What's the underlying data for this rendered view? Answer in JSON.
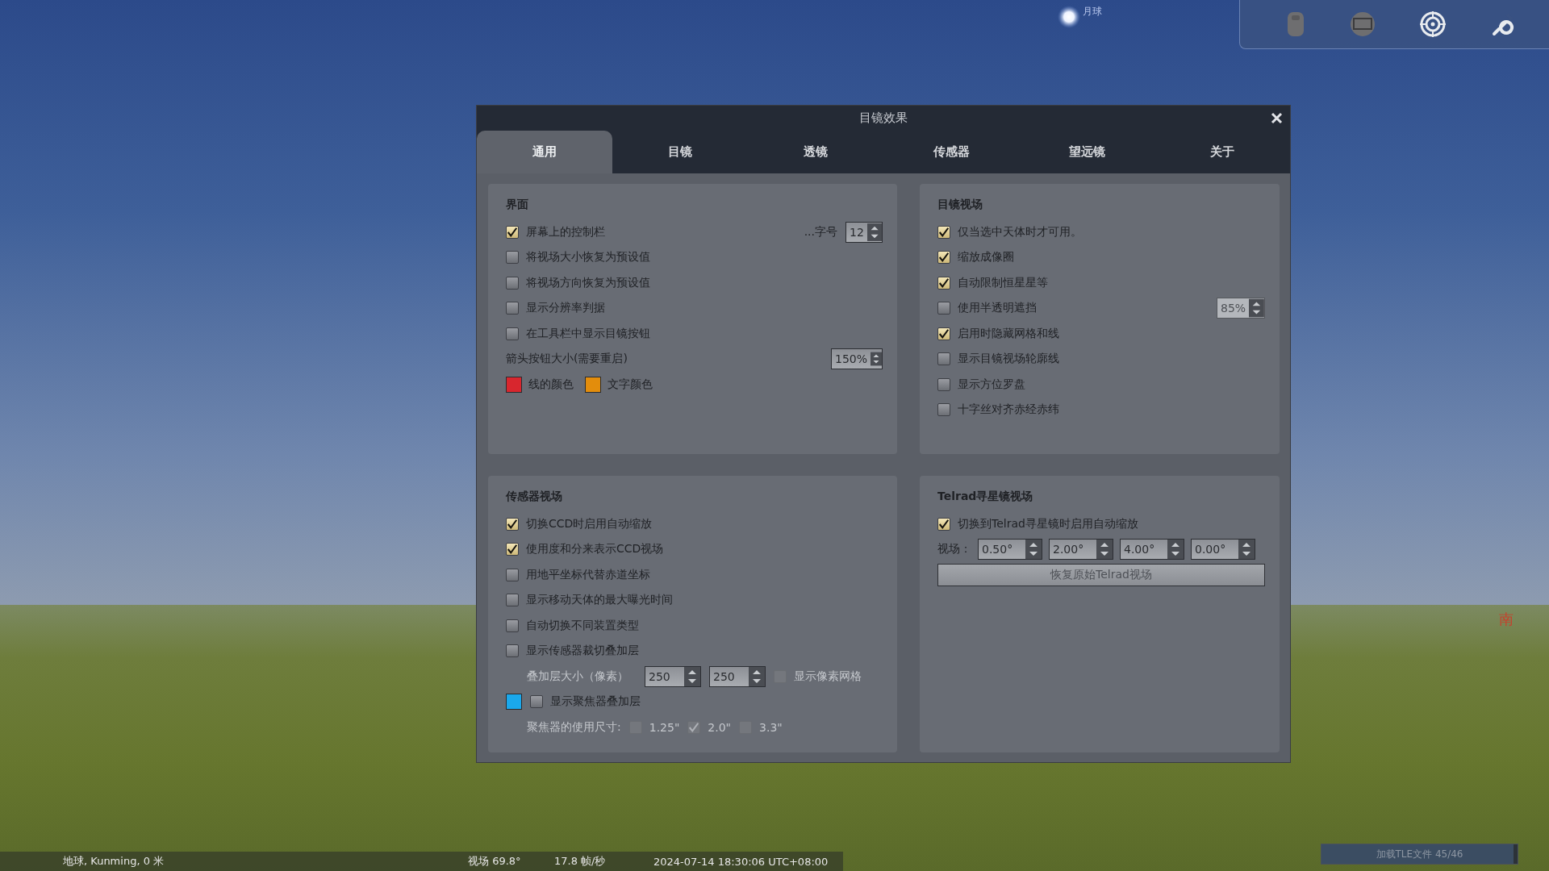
{
  "sky": {
    "moon_label": "月球",
    "cardinal": "南"
  },
  "dialog": {
    "title": "目镜效果",
    "tabs": [
      {
        "label": "通用",
        "selected": true
      },
      {
        "label": "目镜",
        "selected": false
      },
      {
        "label": "透镜",
        "selected": false
      },
      {
        "label": "传感器",
        "selected": false
      },
      {
        "label": "望远镜",
        "selected": false
      },
      {
        "label": "关于",
        "selected": false
      }
    ],
    "panels": [
      {
        "title": "界面",
        "rows": [
          {
            "kind": "check",
            "label": "屏幕上的控制栏",
            "checked": true,
            "spin": {
              "label": "...字号",
              "value": "12",
              "disabled": false
            }
          },
          {
            "kind": "check",
            "label": "将视场大小恢复为预设值",
            "checked": false
          },
          {
            "kind": "check",
            "label": "将视场方向恢复为预设值",
            "checked": false
          },
          {
            "kind": "check",
            "label": "显示分辨率判据",
            "checked": false
          },
          {
            "kind": "check",
            "label": "在工具栏中显示目镜按钮",
            "checked": false
          },
          {
            "kind": "spin",
            "label": "箭头按钮大小(需要重启)",
            "value": "150%",
            "disabled": false
          },
          {
            "kind": "colors",
            "items": [
              {
                "label": "线的颜色",
                "color": "#d8262e"
              },
              {
                "label": "文字颜色",
                "color": "#e38d0c"
              }
            ]
          }
        ]
      },
      {
        "title": "目镜视场",
        "rows": [
          {
            "kind": "check",
            "label": "仅当选中天体时才可用。",
            "checked": true
          },
          {
            "kind": "check",
            "label": "缩放成像圈",
            "checked": true
          },
          {
            "kind": "check",
            "label": "自动限制恒星星等",
            "checked": true
          },
          {
            "kind": "check",
            "label": "使用半透明遮挡",
            "checked": false,
            "spin": {
              "value": "85%",
              "disabled": true
            }
          },
          {
            "kind": "check",
            "label": "启用时隐藏网格和线",
            "checked": true
          },
          {
            "kind": "check",
            "label": "显示目镜视场轮廓线",
            "checked": false
          },
          {
            "kind": "check",
            "label": "显示方位罗盘",
            "checked": false
          },
          {
            "kind": "check",
            "label": "十字丝对齐赤经赤纬",
            "checked": false
          }
        ]
      },
      {
        "title": "传感器视场",
        "rows": [
          {
            "kind": "check",
            "label": "切换CCD时启用自动缩放",
            "checked": true
          },
          {
            "kind": "check",
            "label": "使用度和分来表示CCD视场",
            "checked": true
          },
          {
            "kind": "check",
            "label": "用地平坐标代替赤道坐标",
            "checked": false
          },
          {
            "kind": "check",
            "label": "显示移动天体的最大曝光时间",
            "checked": false
          },
          {
            "kind": "check",
            "label": "自动切换不同装置类型",
            "checked": false
          },
          {
            "kind": "check",
            "label": "显示传感器裁切叠加层",
            "checked": false
          },
          {
            "kind": "sizes",
            "label": "叠加层大小（像素）",
            "disabled": true,
            "values": [
              "250",
              "250"
            ],
            "check": {
              "label": "显示像素网格",
              "checked": false
            }
          },
          {
            "kind": "colorcheck",
            "color": "#1aa8ec",
            "label": "显示聚焦器叠加层",
            "checked": false
          },
          {
            "kind": "options",
            "label": "聚焦器的使用尺寸:",
            "disabled": true,
            "options": [
              {
                "label": "1.25\"",
                "checked": false
              },
              {
                "label": "2.0\"",
                "checked": true
              },
              {
                "label": "3.3\"",
                "checked": false
              }
            ]
          }
        ]
      },
      {
        "title": "Telrad寻星镜视场",
        "rows": [
          {
            "kind": "check",
            "label": "切换到Telrad寻星镜时启用自动缩放",
            "checked": true
          },
          {
            "kind": "fields",
            "label": "视场：",
            "values": [
              "0.50°",
              "2.00°",
              "4.00°",
              "0.00°"
            ]
          },
          {
            "kind": "button",
            "label": "恢复原始Telrad视场"
          }
        ]
      }
    ]
  },
  "status_bar": {
    "location": "地球, Kunming, 0 米",
    "fov": "视场 69.8°",
    "fps": "17.8 帧/秒",
    "datetime": "2024-07-14 18:30:06 UTC+08:00"
  },
  "progress": {
    "label": "加载TLE文件 45/46",
    "level": 0.98
  }
}
